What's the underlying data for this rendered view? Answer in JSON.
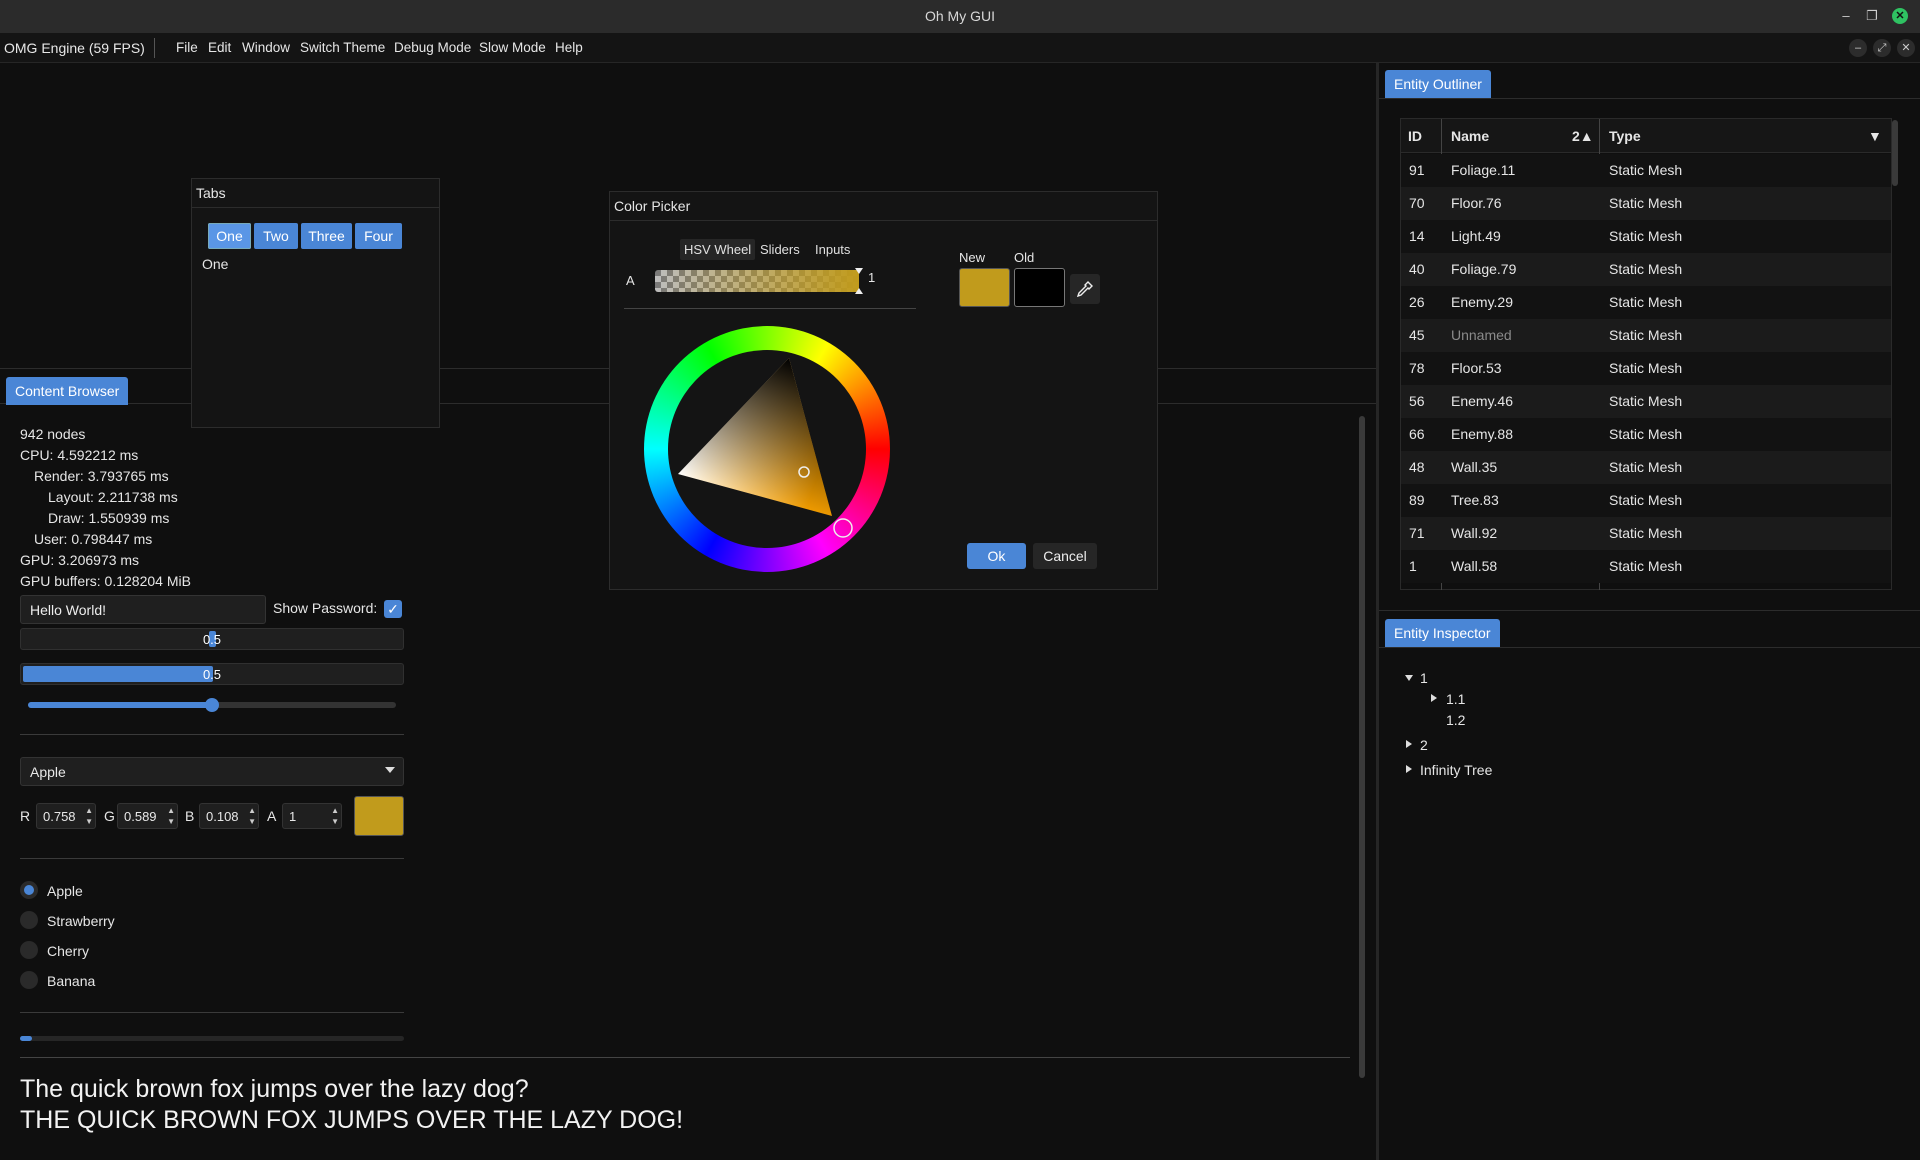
{
  "window": {
    "title": "Oh My GUI"
  },
  "menubar": {
    "engine": "OMG Engine (59 FPS)",
    "items": [
      "File",
      "Edit",
      "Window",
      "Switch Theme",
      "Debug Mode",
      "Slow Mode",
      "Help"
    ]
  },
  "content_browser": {
    "tab": "Content Browser",
    "stats": {
      "nodes": "942 nodes",
      "cpu": "CPU: 4.592212 ms",
      "render": "Render: 3.793765 ms",
      "layout": "Layout: 2.211738 ms",
      "draw": "Draw: 1.550939 ms",
      "user": "User: 0.798447 ms",
      "gpu": "GPU: 3.206973 ms",
      "gpu_buffers": "GPU buffers: 0.128204 MiB"
    },
    "text_input": "Hello World!",
    "show_password_label": "Show Password:",
    "show_password_checked": true,
    "progress1": {
      "label": "0.5",
      "value": 0.5
    },
    "progress2": {
      "label": "0.5",
      "value": 0.5
    },
    "slider_value": 0.5,
    "dropdown_value": "Apple",
    "color": {
      "r_label": "R",
      "r": "0.758",
      "g_label": "G",
      "g": "0.589",
      "b_label": "B",
      "b": "0.108",
      "a_label": "A",
      "a": "1",
      "hex": "#c19b1c"
    },
    "radios": [
      {
        "label": "Apple",
        "selected": true
      },
      {
        "label": "Strawberry",
        "selected": false
      },
      {
        "label": "Cherry",
        "selected": false
      },
      {
        "label": "Banana",
        "selected": false
      }
    ],
    "small_progress": 0.03,
    "pangram_lower": "The quick brown fox jumps over the lazy dog?",
    "pangram_upper": "THE QUICK BROWN FOX JUMPS OVER THE LAZY DOG!"
  },
  "tabs_window": {
    "title": "Tabs",
    "tabs": [
      "One",
      "Two",
      "Three",
      "Four"
    ],
    "active_tab": "One",
    "content": "One"
  },
  "color_picker": {
    "title": "Color Picker",
    "modes": [
      "HSV Wheel",
      "Sliders",
      "Inputs"
    ],
    "active_mode": "HSV Wheel",
    "alpha_label": "A",
    "alpha_value": "1",
    "new_label": "New",
    "old_label": "Old",
    "new_color": "#c19b1c",
    "old_color": "#000000",
    "ok": "Ok",
    "cancel": "Cancel"
  },
  "entity_outliner": {
    "tab": "Entity Outliner",
    "columns": {
      "id": "ID",
      "name": "Name",
      "name_sort": "2▲",
      "type": "Type",
      "type_sort": "▼"
    },
    "rows": [
      {
        "id": "91",
        "name": "Foliage.11",
        "type": "Static Mesh"
      },
      {
        "id": "70",
        "name": "Floor.76",
        "type": "Static Mesh"
      },
      {
        "id": "14",
        "name": "Light.49",
        "type": "Static Mesh"
      },
      {
        "id": "40",
        "name": "Foliage.79",
        "type": "Static Mesh"
      },
      {
        "id": "26",
        "name": "Enemy.29",
        "type": "Static Mesh"
      },
      {
        "id": "45",
        "name": "Unnamed",
        "type": "Static Mesh"
      },
      {
        "id": "78",
        "name": "Floor.53",
        "type": "Static Mesh"
      },
      {
        "id": "56",
        "name": "Enemy.46",
        "type": "Static Mesh"
      },
      {
        "id": "66",
        "name": "Enemy.88",
        "type": "Static Mesh"
      },
      {
        "id": "48",
        "name": "Wall.35",
        "type": "Static Mesh"
      },
      {
        "id": "89",
        "name": "Tree.83",
        "type": "Static Mesh"
      },
      {
        "id": "71",
        "name": "Wall.92",
        "type": "Static Mesh"
      },
      {
        "id": "1",
        "name": "Wall.58",
        "type": "Static Mesh"
      }
    ]
  },
  "entity_inspector": {
    "tab": "Entity Inspector",
    "tree": {
      "n1": "1",
      "n11": "1.1",
      "n12": "1.2",
      "n2": "2",
      "ninf": "Infinity Tree"
    }
  },
  "accent": "#4a86d6"
}
